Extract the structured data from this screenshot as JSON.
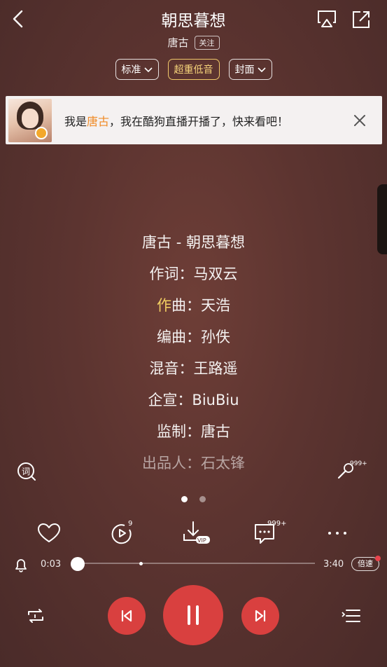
{
  "header": {
    "song_title": "朝思暮想",
    "artist": "唐古",
    "follow_label": "关注"
  },
  "options": {
    "quality": "标准",
    "effect": "超重低音",
    "view": "封面"
  },
  "banner": {
    "text_prefix": "我是",
    "highlight_name": "唐古",
    "text_suffix": "，我在酷狗直播开播了，快来看吧！"
  },
  "lyrics": {
    "line1": "唐古 - 朝思暮想",
    "line2": "作词：马双云",
    "line3_highlight": "作",
    "line3_rest": "曲：天浩",
    "line4": "编曲：孙佚",
    "line5": "混音：王路遥",
    "line6": "企宣：BiuBiu",
    "line7": "监制：唐古",
    "line8": "出品人：石太锋"
  },
  "side_icons": {
    "lyric_icon": "ci-icon",
    "mic_count": "999+"
  },
  "actions": {
    "play_count_badge": "9",
    "comment_count": "999+",
    "download_tag": "VIP"
  },
  "progress": {
    "current_time": "0:03",
    "total_time": "3:40",
    "fraction": 0.014,
    "speed_label": "倍速"
  },
  "colors": {
    "accent_red": "#d9403f",
    "highlight_orange": "#f08a25",
    "lyric_gold": "#f2cf62"
  }
}
